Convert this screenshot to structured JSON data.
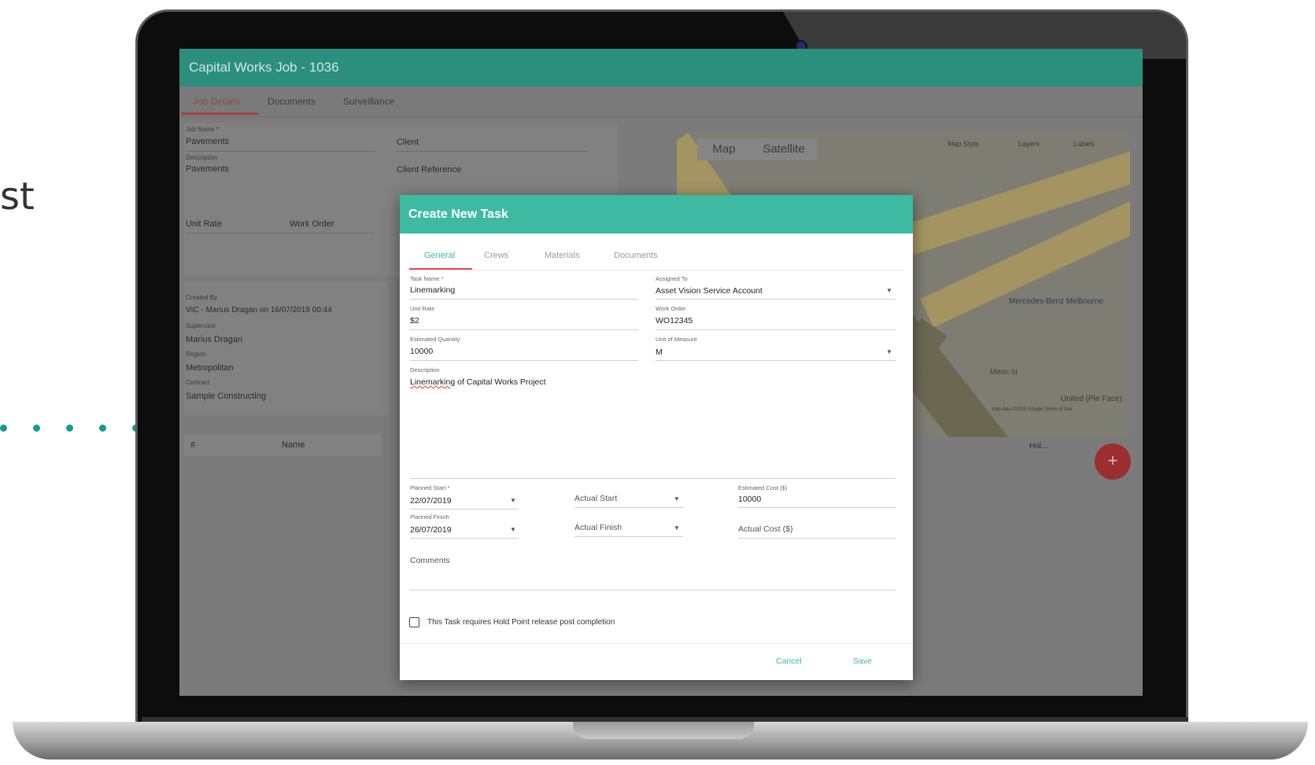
{
  "page": {
    "side_text": "st"
  },
  "app": {
    "title": "Capital Works Job - 1036",
    "tabs": [
      {
        "label": "Job Details"
      },
      {
        "label": "Documents"
      },
      {
        "label": "Surveillance"
      }
    ],
    "job": {
      "job_name_label": "Job Name *",
      "job_name": "Pavements",
      "description_label": "Description",
      "description": "Pavements",
      "client_placeholder": "Client",
      "client_reference_placeholder": "Client Reference",
      "unit_rate_placeholder": "Unit Rate",
      "work_order_placeholder": "Work Order",
      "created_by_label": "Created By",
      "created_by": "VIC - Marius Dragan on 16/07/2019 00:44",
      "supervisor_label": "Supervisor",
      "supervisor": "Marius Dragan",
      "region_label": "Region",
      "region": "Metropolitan",
      "contract_label": "Contract",
      "contract": "Sample Constructing"
    },
    "table": {
      "col_hash": "#",
      "col_name": "Name",
      "col_hol": "Hol..."
    },
    "map": {
      "map_button": "Map",
      "satellite_button": "Satellite",
      "map_style": "Map Style",
      "layers": "Layers",
      "labels": "Labels",
      "place_label": "Mercedes-Benz Melbourne",
      "street_label": "Milton St",
      "footer_text": "United (Pie Face)",
      "attribution": "Map data ©2019 Google   Terms of Use"
    },
    "fab": "+"
  },
  "dialog": {
    "title": "Create New Task",
    "tabs": [
      {
        "label": "General"
      },
      {
        "label": "Crews"
      },
      {
        "label": "Materials"
      },
      {
        "label": "Documents"
      }
    ],
    "fields": {
      "task_name_label": "Task Name *",
      "task_name": "Linemarking",
      "assigned_to_label": "Assigned To",
      "assigned_to": "Asset Vision Service Account",
      "unit_rate_label": "Unit Rate",
      "unit_rate": "$2",
      "work_order_label": "Work Order",
      "work_order": "WO12345",
      "estimated_quantity_label": "Estimated Quantity",
      "estimated_quantity": "10000",
      "unit_of_measure_label": "Unit of Measure",
      "unit_of_measure": "M",
      "description_label": "Description",
      "description_word": "Linemarking",
      "description_rest": " of Capital Works Project",
      "planned_start_label": "Planned Start *",
      "planned_start": "22/07/2019",
      "actual_start_placeholder": "Actual Start",
      "estimated_cost_label": "Estimated Cost ($)",
      "estimated_cost": "10000",
      "planned_finish_label": "Planned Finish",
      "planned_finish": "26/07/2019",
      "actual_finish_placeholder": "Actual Finish",
      "actual_cost_placeholder": "Actual Cost ($)",
      "comments_placeholder": "Comments"
    },
    "hold_point_label": "This Task requires Hold Point release post completion",
    "hold_point_checked": false,
    "cancel_label": "Cancel",
    "save_label": "Save"
  },
  "colors": {
    "brand": "#3ebaa3",
    "accent": "#e34b4b"
  }
}
